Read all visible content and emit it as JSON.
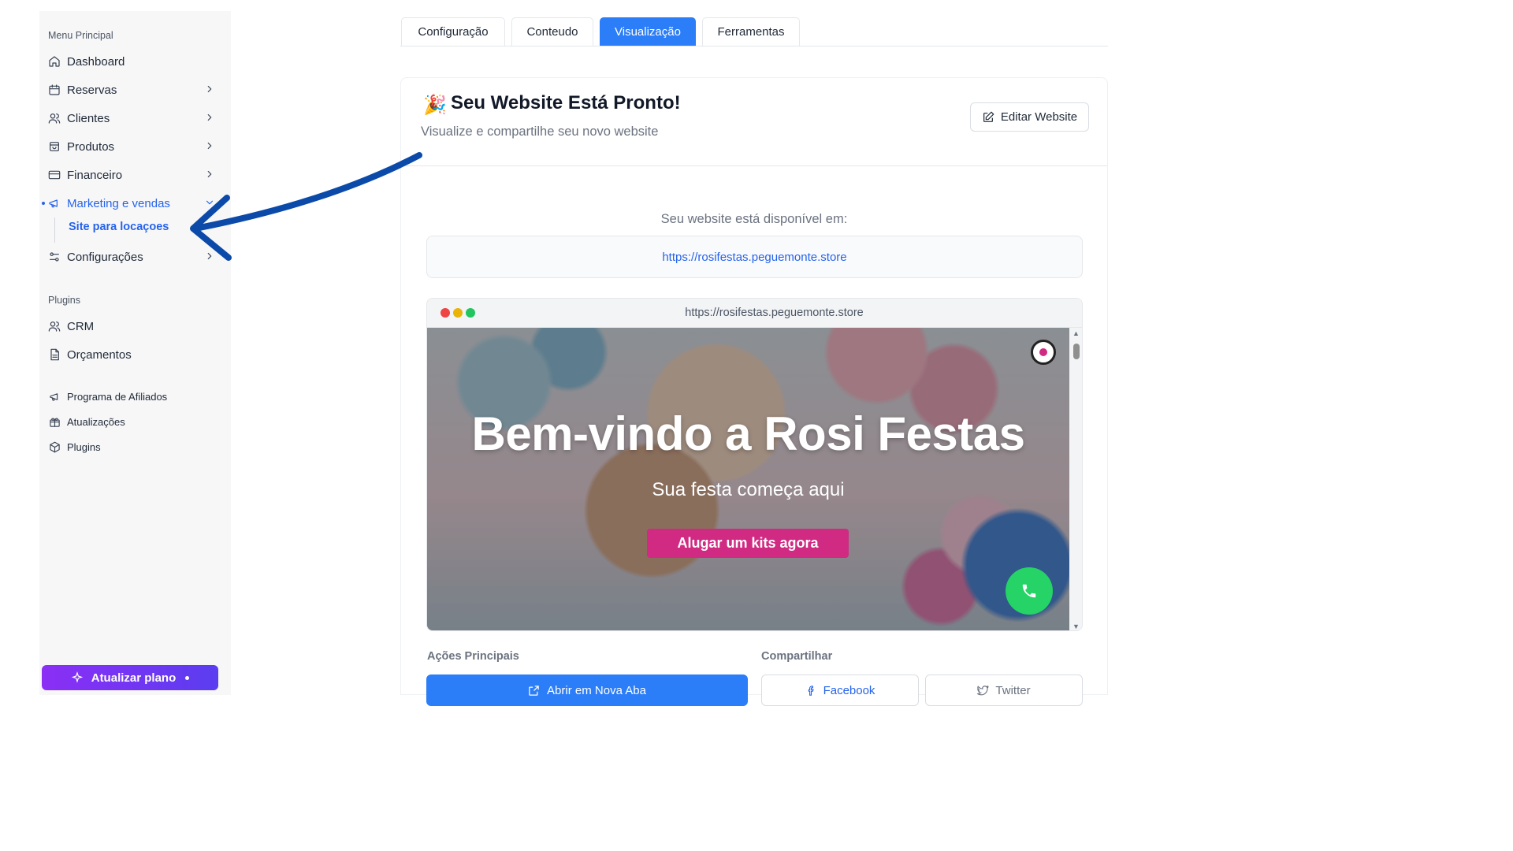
{
  "sidebar": {
    "main_title": "Menu Principal",
    "items": [
      {
        "label": "Dashboard",
        "icon": "home-icon"
      },
      {
        "label": "Reservas",
        "icon": "calendar-icon"
      },
      {
        "label": "Clientes",
        "icon": "users-icon"
      },
      {
        "label": "Produtos",
        "icon": "package-icon"
      },
      {
        "label": "Financeiro",
        "icon": "credit-card-icon"
      },
      {
        "label": "Marketing e vendas",
        "icon": "megaphone-icon"
      },
      {
        "label": "Configurações",
        "icon": "settings-icon"
      }
    ],
    "sub_item": "Site para locaçoes",
    "plugins_title": "Plugins",
    "plugin_items": [
      {
        "label": "CRM",
        "icon": "users-icon"
      },
      {
        "label": "Orçamentos",
        "icon": "document-icon"
      }
    ],
    "extra_items": [
      {
        "label": "Programa de Afiliados",
        "icon": "megaphone-icon"
      },
      {
        "label": "Atualizações",
        "icon": "gift-icon"
      },
      {
        "label": "Plugins",
        "icon": "box-icon"
      }
    ],
    "upgrade_label": "Atualizar plano"
  },
  "tabs": [
    "Configuração",
    "Conteudo",
    "Visualização",
    "Ferramentas"
  ],
  "active_tab": "Visualização",
  "card": {
    "emoji": "🎉",
    "title": "Seu Website Está Pronto!",
    "subtitle": "Visualize e compartilhe seu novo website",
    "edit_label": "Editar Website",
    "available_label": "Seu website está disponível em:",
    "url": "https://rosifestas.peguemonte.store"
  },
  "preview": {
    "address": "https://rosifestas.peguemonte.store",
    "hero_title": "Bem-vindo a Rosi Festas",
    "hero_subtitle": "Sua festa começa aqui",
    "cta_label": "Alugar um kits agora"
  },
  "actions": {
    "main_label": "Ações Principais",
    "open_label": "Abrir em Nova Aba",
    "share_label": "Compartilhar",
    "facebook_label": "Facebook",
    "twitter_label": "Twitter"
  },
  "colors": {
    "accent": "#2b7df8",
    "active_nav": "#2563eb",
    "cta": "#d02a83",
    "whatsapp": "#25d366",
    "arrow": "#0b4aa8"
  }
}
